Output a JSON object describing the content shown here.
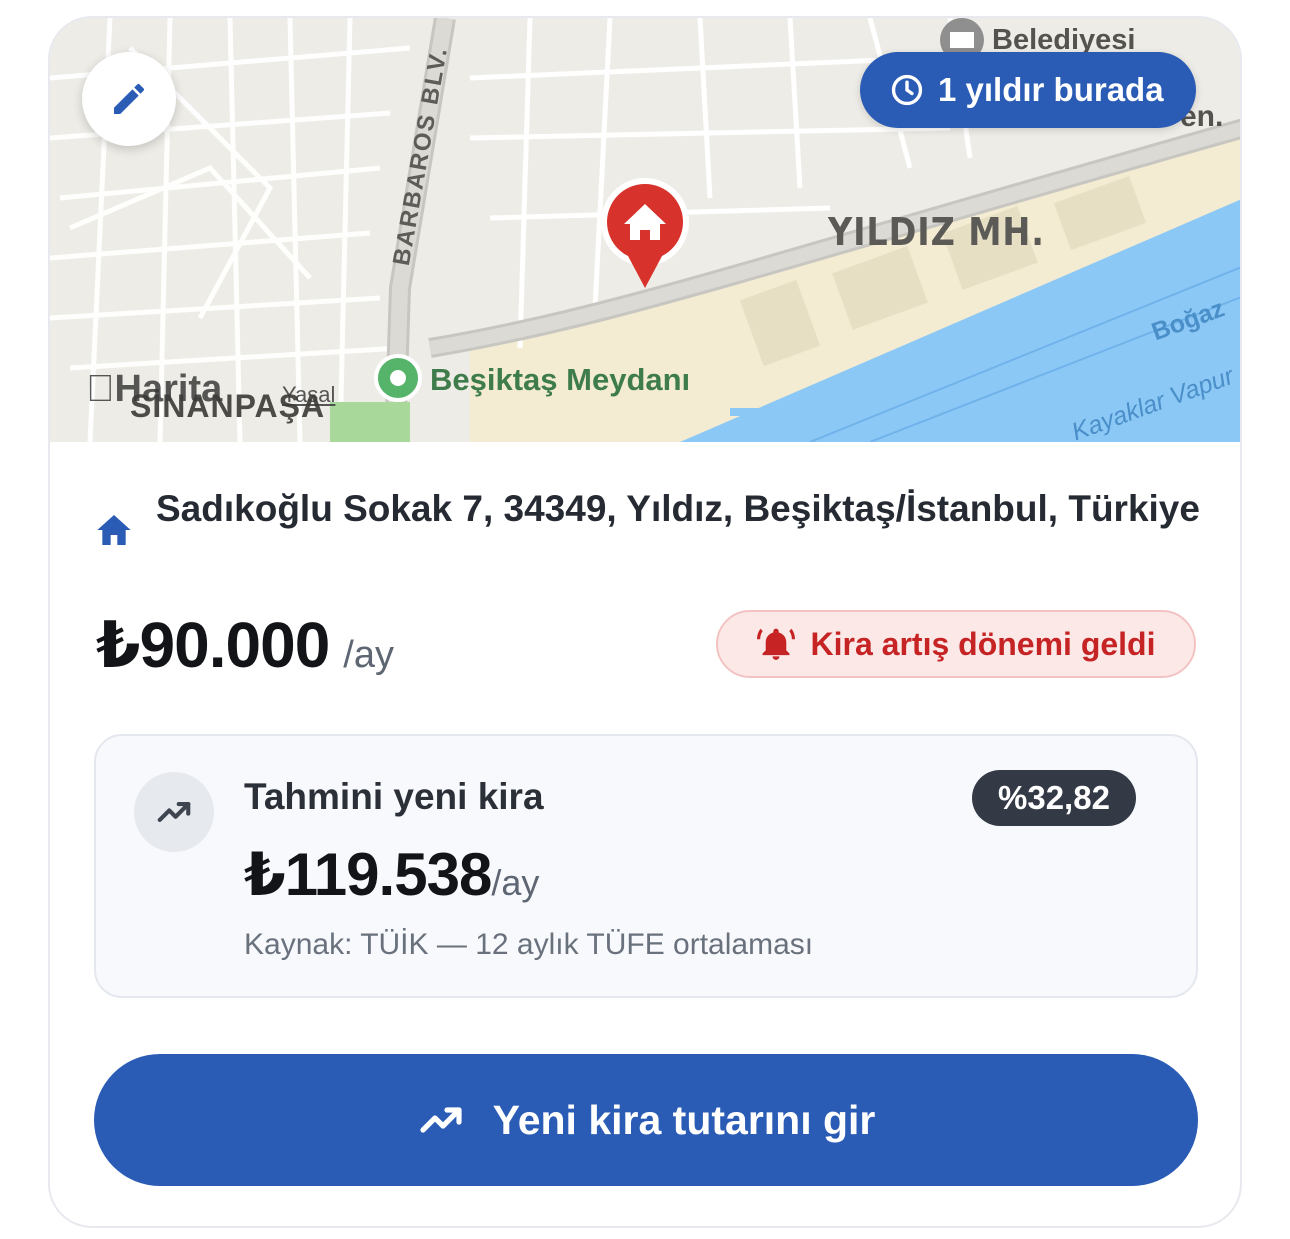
{
  "colors": {
    "primary": "#2a5bb5",
    "alert_text": "#c62424",
    "alert_bg": "#fde8e8",
    "pin": "#d7322b",
    "water": "#8cc8f5",
    "dark_badge": "#333a46"
  },
  "map": {
    "tenure_badge": "1 yıldır burada",
    "tenure_icon": "clock-icon",
    "edit_icon": "pencil-icon",
    "pin_icon": "home-pin-icon",
    "labels": {
      "district": "YILDIZ MH.",
      "boulevard": "BARBAROS BLV.",
      "square": "Beşiktaş Meydanı",
      "municipality": "Belediyesi",
      "strait": "Boğaz",
      "ferry": "Kayaklar Vapur",
      "neighborhood": "SİNANPAŞA",
      "attribution": "Harita",
      "legal": "Yasal",
      "partial": "en."
    }
  },
  "property": {
    "address_icon": "home-icon",
    "address": "Sadıkoğlu Sokak 7, 34349, Yıldız, Beşiktaş/İstanbul, Türkiye",
    "rent": "₺90.000",
    "rent_unit": "/ay",
    "alert_icon": "bell-ringing-icon",
    "alert_text": "Kira artış dönemi geldi"
  },
  "estimate": {
    "icon": "trending-up-icon",
    "title": "Tahmini yeni kira",
    "percent": "%32,82",
    "amount": "₺119.538",
    "unit": "/ay",
    "source": "Kaynak: TÜİK — 12 aylık TÜFE ortalaması"
  },
  "cta": {
    "icon": "trending-up-icon",
    "label": "Yeni kira tutarını gir"
  }
}
